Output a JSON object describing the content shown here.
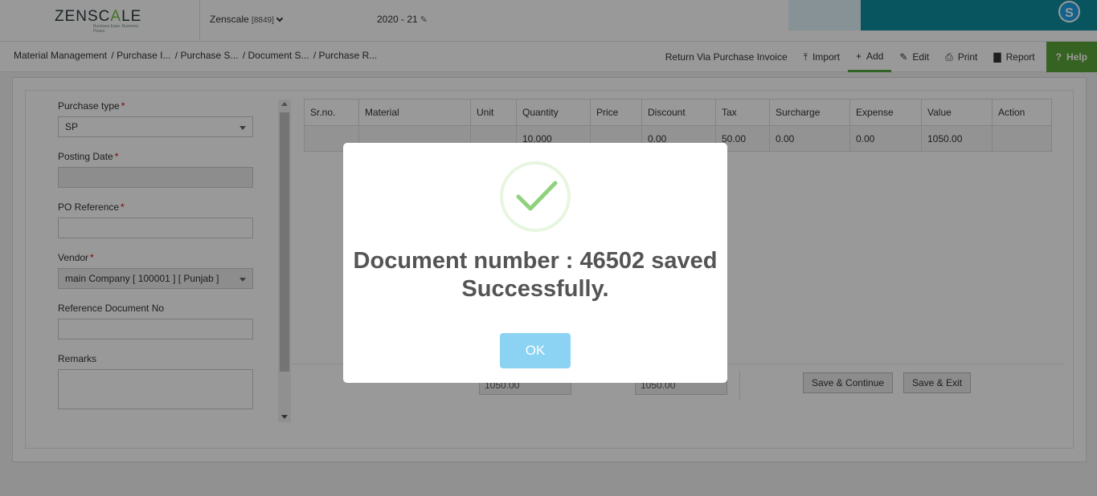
{
  "header": {
    "logo_text_start": "ZENSC",
    "logo_text_accent": "A",
    "logo_text_end": "LE",
    "logo_tagline": "Business Ease. Business Peace.",
    "company_name": "Zenscale",
    "company_code": "[8849]",
    "financial_year": "2020 - 21"
  },
  "breadcrumb": {
    "items": [
      "Material Management",
      "/ Purchase I...",
      "/ Purchase S...",
      "/ Document S...",
      "/ Purchase R..."
    ]
  },
  "toolbar": {
    "return_label": "Return Via Purchase Invoice",
    "import_label": "Import",
    "add_label": "Add",
    "edit_label": "Edit",
    "print_label": "Print",
    "report_label": "Report",
    "help_label": "Help"
  },
  "form": {
    "purchase_type_label": "Purchase type",
    "purchase_type_value": "SP",
    "posting_date_label": "Posting Date",
    "posting_date_value": "",
    "po_reference_label": "PO Reference",
    "po_reference_value": "",
    "vendor_label": "Vendor",
    "vendor_value": "main Company [ 100001 ] [ Punjab ]",
    "ref_doc_label": "Reference Document No",
    "ref_doc_value": "",
    "remarks_label": "Remarks",
    "remarks_value": "",
    "required_mark": "*"
  },
  "table": {
    "headers": [
      "Sr.no.",
      "Material",
      "Unit",
      "Quantity",
      "Price",
      "Discount",
      "Tax",
      "Surcharge",
      "Expense",
      "Value",
      "Action"
    ],
    "rows": [
      [
        "",
        "",
        "",
        "10.000",
        "",
        "0.00",
        "50.00",
        "0.00",
        "0.00",
        "1050.00",
        ""
      ]
    ]
  },
  "footer": {
    "total_1": "1050.00",
    "total_2": "1050.00",
    "save_continue_label": "Save & Continue",
    "save_exit_label": "Save & Exit"
  },
  "modal": {
    "message_line1": "Document number : 46502 saved",
    "message_line2": "Successfully.",
    "ok_label": "OK"
  },
  "colors": {
    "accent_green": "#5aa638",
    "ok_button": "#8cd3f3",
    "promo_teal": "#0e8ea0",
    "check_green": "#8fd27b"
  }
}
